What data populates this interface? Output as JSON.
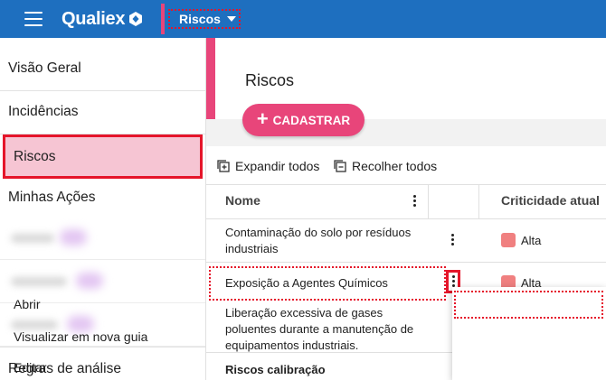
{
  "header": {
    "brand": "Qualiex",
    "module": "Riscos",
    "colors": {
      "bar": "#1e6fbf",
      "accent": "#e8457a",
      "highlight": "#e5152a"
    }
  },
  "sidebar": {
    "items": [
      {
        "label": "Visão Geral"
      },
      {
        "label": "Incidências"
      },
      {
        "label": "Riscos",
        "active": true
      },
      {
        "label": "Minhas Ações"
      },
      {
        "label": "Regras de análise"
      }
    ]
  },
  "main": {
    "title": "Riscos",
    "add_label": "CADASTRAR",
    "expand_label": "Expandir todos",
    "collapse_label": "Recolher todos",
    "columns": {
      "name": "Nome",
      "criticality": "Criticidade atual"
    },
    "rows": [
      {
        "name": "Contaminação do solo por resíduos industriais",
        "criticality": "Alta",
        "color": "#f08080"
      },
      {
        "name": "Exposição a Agentes Químicos",
        "criticality": "Alta",
        "color": "#f08080"
      },
      {
        "name": "Liberação excessiva de gases poluentes durante a manutenção de equipamentos industriais."
      }
    ],
    "group_label": "Riscos calibração"
  },
  "context_menu": {
    "items": [
      {
        "label": "Abrir"
      },
      {
        "label": "Visualizar em nova guia"
      },
      {
        "label": "Editar"
      }
    ]
  },
  "icons": [
    "menu-icon",
    "qualiex-logo-icon",
    "caret-down-icon",
    "plus-icon",
    "expand-icon",
    "collapse-icon",
    "more-vert-icon"
  ]
}
